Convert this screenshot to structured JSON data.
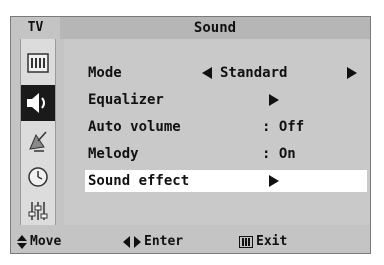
{
  "header": {
    "tv_tab": "TV",
    "title": "Sound"
  },
  "sidebar": {
    "items": [
      {
        "icon": "picture-menu-icon"
      },
      {
        "icon": "sound-speaker-icon",
        "selected": true
      },
      {
        "icon": "channel-antenna-icon"
      },
      {
        "icon": "time-clock-icon"
      },
      {
        "icon": "setup-sliders-icon"
      }
    ]
  },
  "menu": {
    "items": [
      {
        "label": "Mode",
        "value": "Standard",
        "arrows": "both"
      },
      {
        "label": "Equalizer",
        "value": "",
        "arrows": "right"
      },
      {
        "label": "Auto volume",
        "value": ": Off",
        "arrows": "none"
      },
      {
        "label": "Melody",
        "value": ": On",
        "arrows": "none"
      },
      {
        "label": "Sound effect",
        "value": "",
        "arrows": "right",
        "selected": true
      }
    ]
  },
  "footer": {
    "move": "Move",
    "enter": "Enter",
    "exit": "Exit"
  },
  "colors": {
    "panel": "#c4c4c4",
    "title_bar": "#b6b6b6",
    "selected_icon_bg": "#1a1a1a",
    "selected_row_bg": "#ffffff"
  }
}
